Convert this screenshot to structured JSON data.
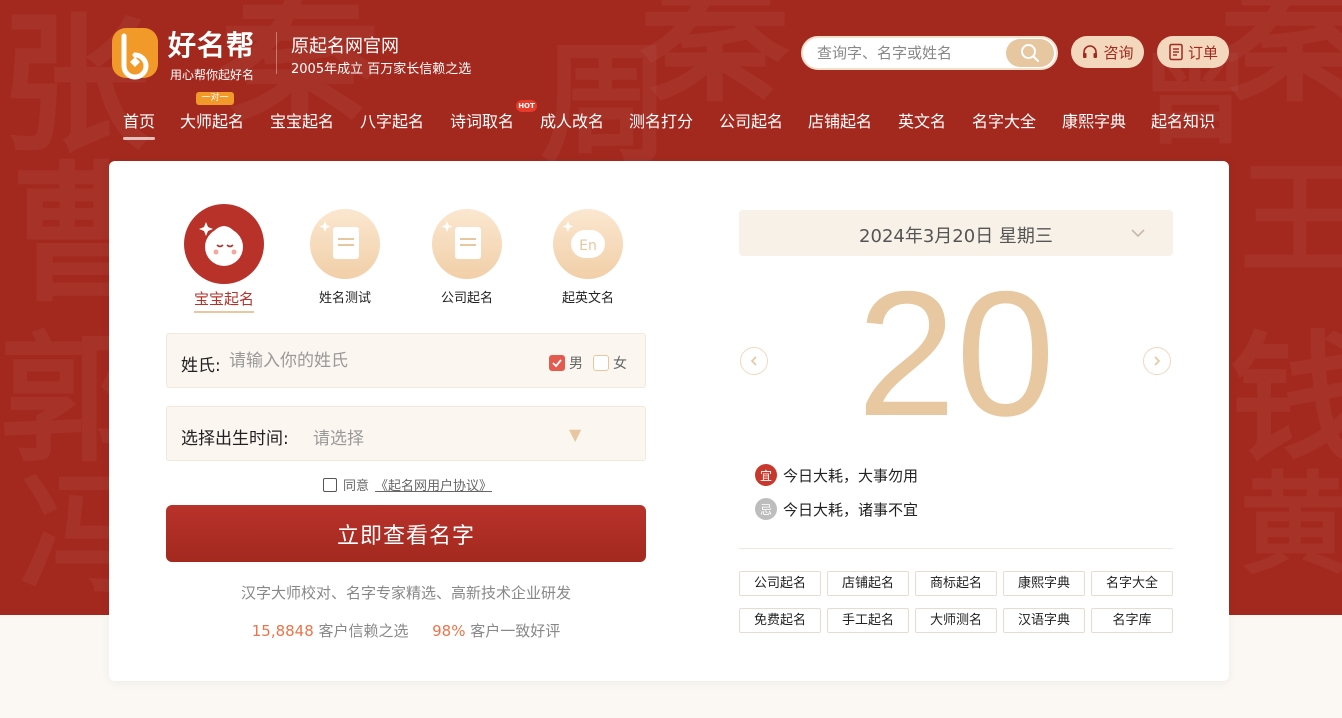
{
  "header": {
    "logo_text": "好名帮",
    "logo_slogan": "用心帮你起好名",
    "site_title": "原起名网官网",
    "site_subtitle": "2005年成立 百万家长信赖之选",
    "search_placeholder": "查询字、名字或姓名",
    "consult_label": "咨询",
    "orders_label": "订单"
  },
  "nav": {
    "items": [
      "首页",
      "大师起名",
      "宝宝起名",
      "八字起名",
      "诗词取名",
      "成人改名",
      "测名打分",
      "公司起名",
      "店铺起名",
      "英文名",
      "名字大全",
      "康熙字典",
      "起名知识"
    ],
    "badge_1v1": "一对一",
    "badge_hot": "HOT"
  },
  "types": [
    {
      "label": "宝宝起名",
      "active": true
    },
    {
      "label": "姓名测试",
      "active": false
    },
    {
      "label": "公司起名",
      "active": false
    },
    {
      "label": "起英文名",
      "active": false
    }
  ],
  "form": {
    "surname_label": "姓氏:",
    "surname_placeholder": "请输入你的姓氏",
    "male_label": "男",
    "female_label": "女",
    "birth_label": "选择出生时间:",
    "birth_placeholder": "请选择",
    "agree_prefix": "同意",
    "agree_link": "《起名网用户协议》",
    "submit_label": "立即查看名字"
  },
  "promo": {
    "tagline": "汉字大师校对、名字专家精选、高新技术企业研发",
    "stat1_num": "15,8848",
    "stat1_text": "客户信赖之选",
    "stat2_num": "98%",
    "stat2_text": "客户一致好评"
  },
  "calendar": {
    "date_label": "2024年3月20日 星期三",
    "day": "20",
    "yi_badge": "宜",
    "yi_text": "今日大耗，大事勿用",
    "ji_badge": "忌",
    "ji_text": "今日大耗，诸事不宜"
  },
  "quick_links": [
    "公司起名",
    "店铺起名",
    "商标起名",
    "康熙字典",
    "名字大全",
    "免费起名",
    "手工起名",
    "大师测名",
    "汉语字典",
    "名字库"
  ],
  "colors": {
    "brand_red": "#a3291f",
    "accent_gold": "#e6c7a0",
    "highlight_orange": "#e9744a"
  }
}
